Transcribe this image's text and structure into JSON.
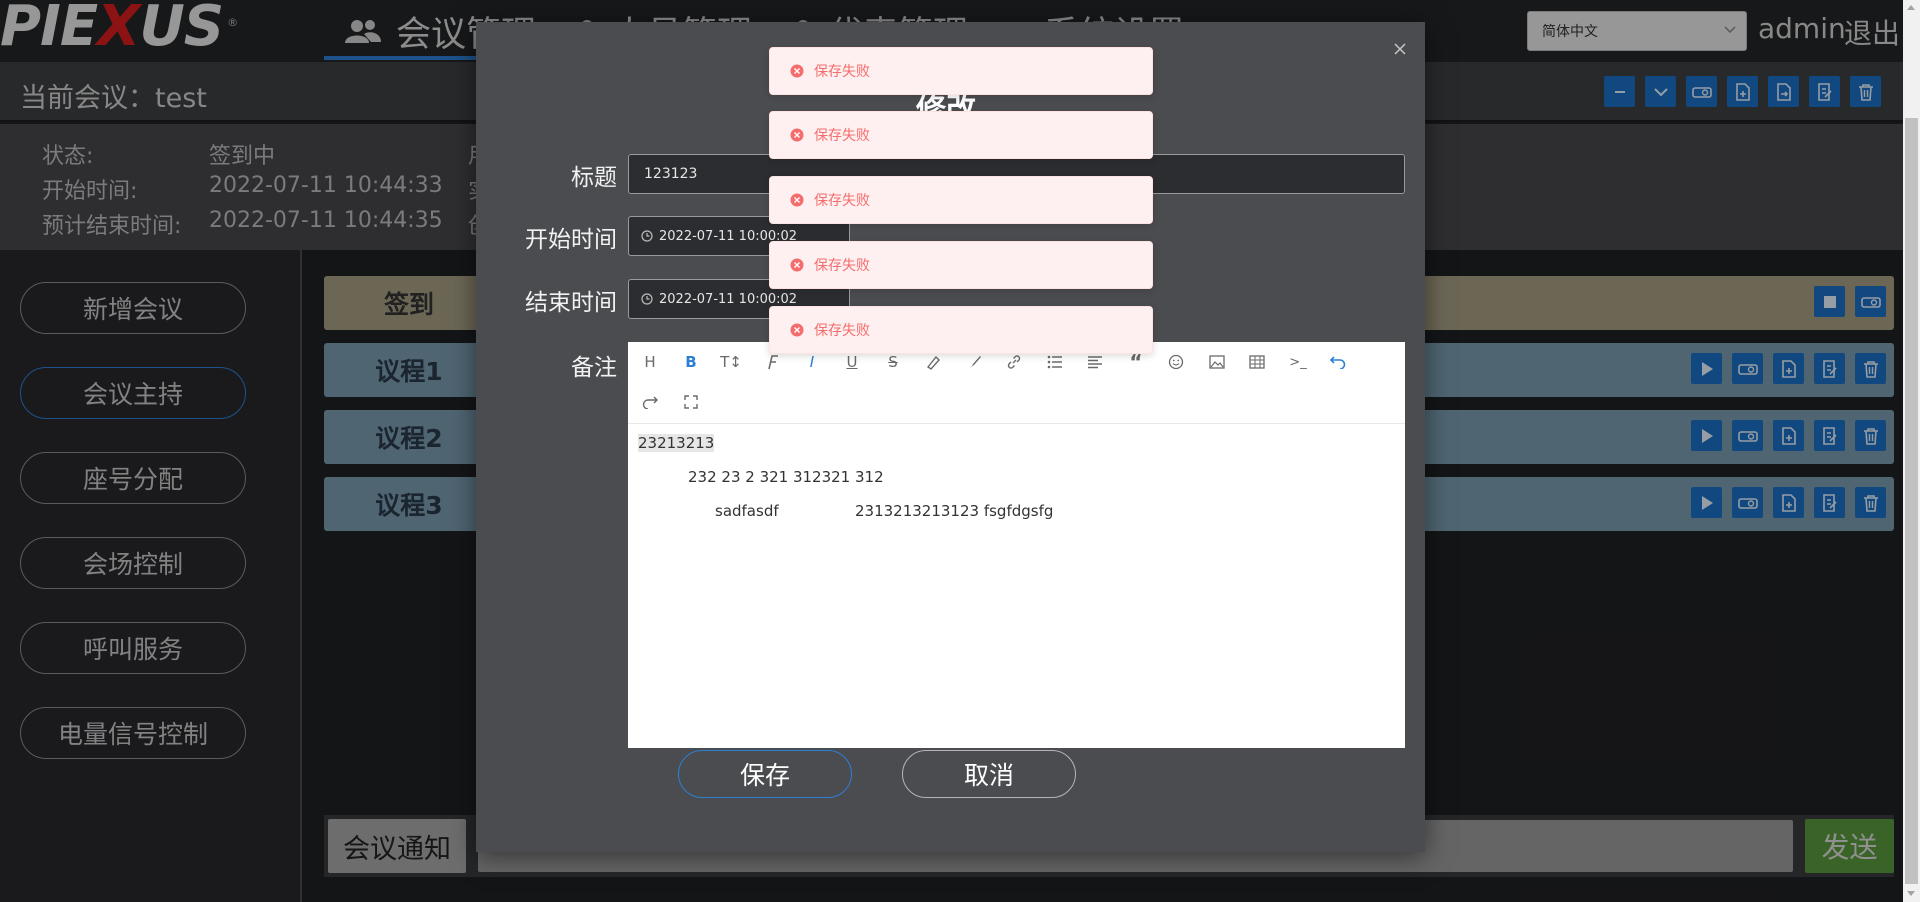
{
  "logo": {
    "text_a": "PIE",
    "text_x": "X",
    "text_b": "US",
    "registered": "®"
  },
  "nav": {
    "items": [
      {
        "label": "会议管理",
        "icon": "users-icon"
      },
      {
        "label": "人员管理",
        "icon": "user-icon"
      },
      {
        "label": "代表管理",
        "icon": "user-icon"
      },
      {
        "label": "系统设置",
        "icon": "gear-icon"
      }
    ]
  },
  "language": {
    "selected": "简体中文"
  },
  "user": {
    "name": "admin",
    "logout": "退出"
  },
  "meeting": {
    "current_label": "当前会议：test"
  },
  "status": {
    "state_label": "状态:",
    "state_value": "签到中",
    "start_label": "开始时间:",
    "start_value": "2022-07-11 10:44:33",
    "end_label": "预计结束时间:",
    "end_value": "2022-07-11 10:44:35",
    "side1": "用",
    "side2": "实",
    "side3": "创"
  },
  "sidebar": {
    "items": [
      {
        "label": "新增会议"
      },
      {
        "label": "会议主持"
      },
      {
        "label": "座号分配"
      },
      {
        "label": "会场控制"
      },
      {
        "label": "呼叫服务"
      },
      {
        "label": "电量信号控制"
      }
    ]
  },
  "agenda": {
    "checkin": "签到",
    "topics": [
      "议程1",
      "议程2",
      "议程3"
    ]
  },
  "notice": {
    "button": "会议通知",
    "send": "发送"
  },
  "modal": {
    "title": "修改",
    "title_label": "标题",
    "title_value": "123123",
    "start_label": "开始时间",
    "start_value": "2022-07-11 10:00:02",
    "end_label": "结束时间",
    "end_value": "2022-07-11 10:00:02",
    "remark_label": "备注",
    "editor_lines": [
      "23213213",
      "232 23 2 321 312321 312",
      "sadfasdf",
      "2313213213123 fsgfdgsfg"
    ],
    "save": "保存",
    "cancel": "取消"
  },
  "toasts": [
    "保存失败",
    "保存失败",
    "保存失败",
    "保存失败",
    "保存失败"
  ],
  "colors": {
    "accent": "#2d7fd6",
    "error": "#f56c6c",
    "send": "#5a9a3c",
    "brand_red": "#d81e1e"
  }
}
